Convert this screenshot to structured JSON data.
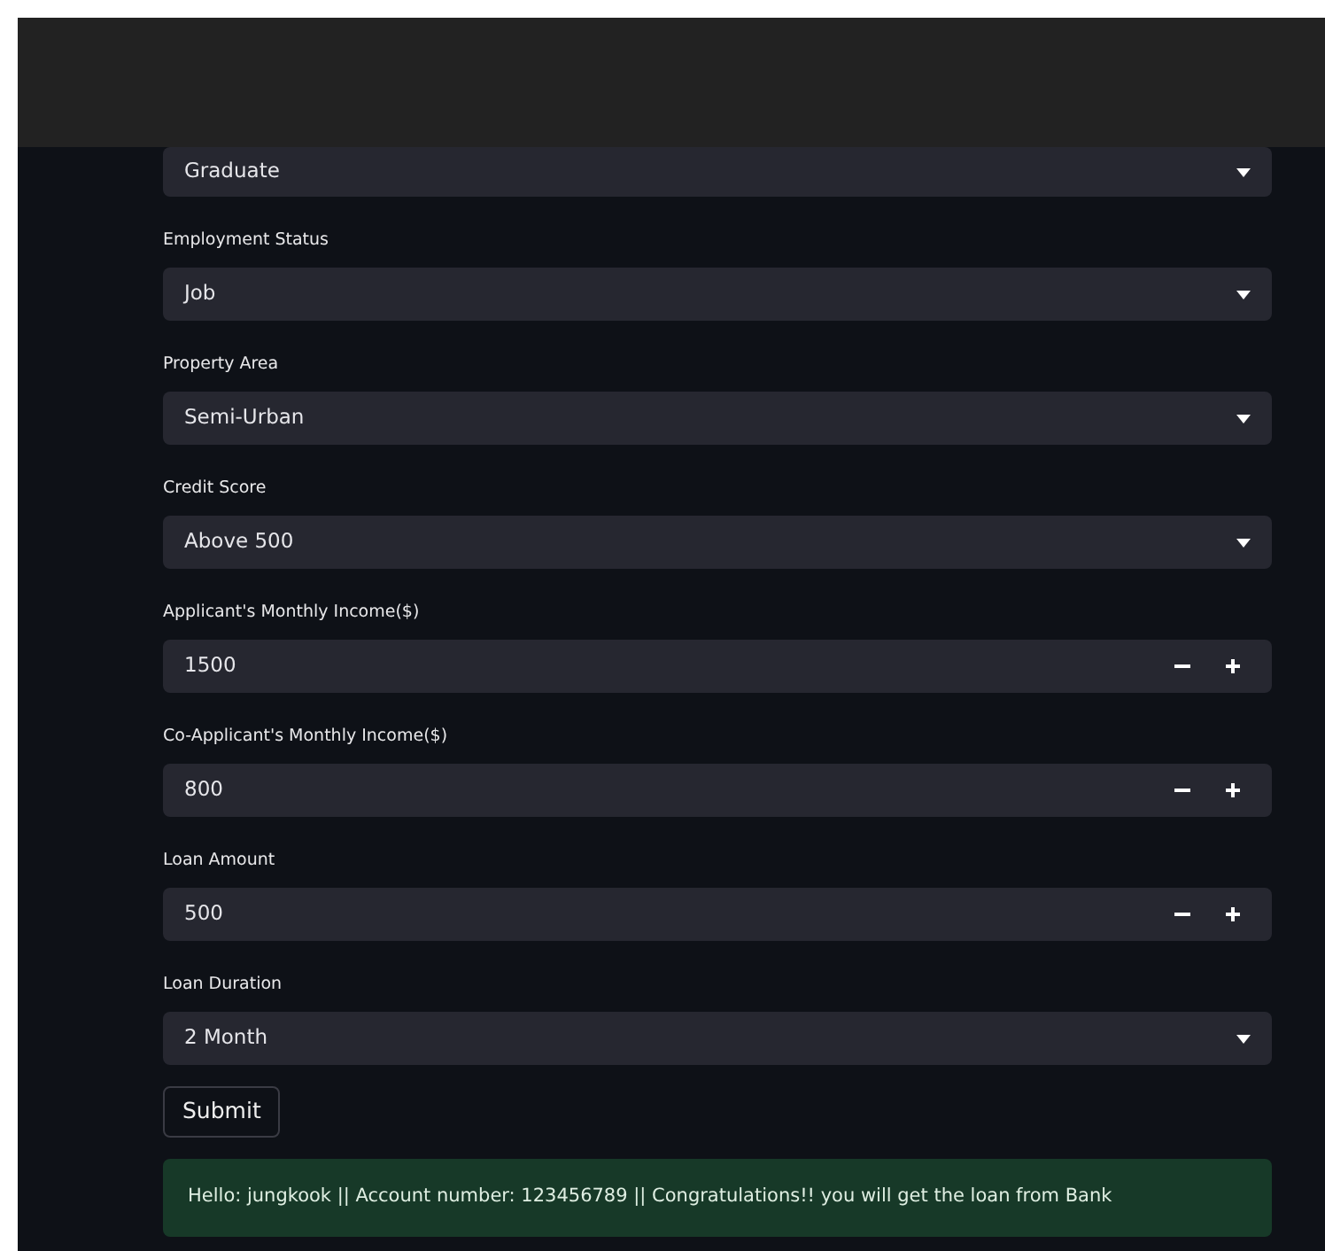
{
  "fields": [
    {
      "kind": "select",
      "value": "Graduate"
    },
    {
      "kind": "select",
      "label": "Employment Status",
      "value": "Job"
    },
    {
      "kind": "select",
      "label": "Property Area",
      "value": "Semi-Urban"
    },
    {
      "kind": "select",
      "label": "Credit Score",
      "value": "Above 500"
    },
    {
      "kind": "number",
      "label": "Applicant's Monthly Income($)",
      "value": "1500"
    },
    {
      "kind": "number",
      "label": "Co-Applicant's Monthly Income($)",
      "value": "800"
    },
    {
      "kind": "number",
      "label": "Loan Amount",
      "value": "500"
    },
    {
      "kind": "select",
      "label": "Loan Duration",
      "value": "2 Month"
    }
  ],
  "submit": {
    "label": "Submit"
  },
  "result": {
    "kind": "success",
    "text": "Hello: jungkook || Account number: 123456789 || Congratulations!! you will get the loan from Bank"
  }
}
